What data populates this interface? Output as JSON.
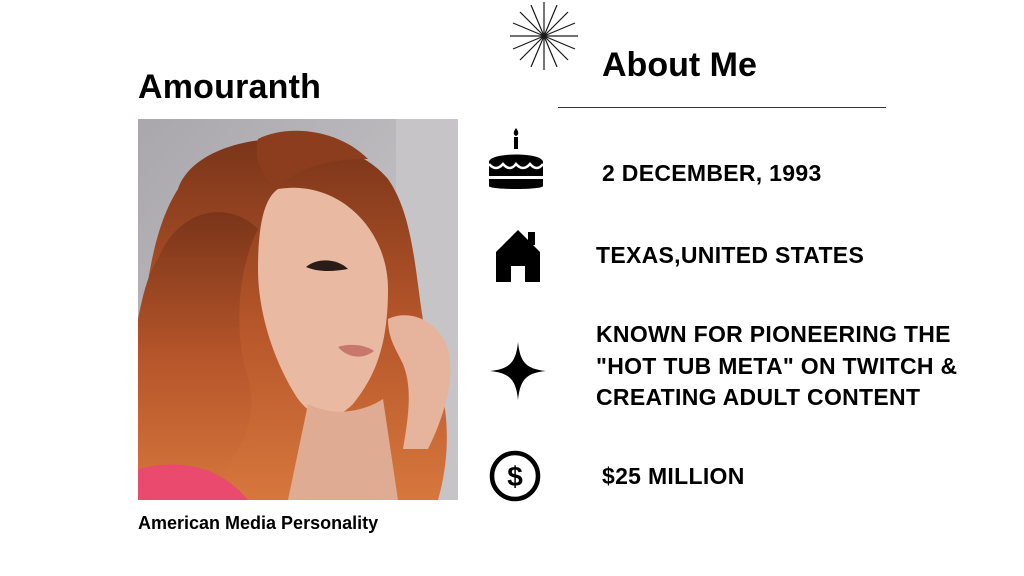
{
  "profile": {
    "name": "Amouranth",
    "caption": "American Media Personality"
  },
  "about": {
    "heading": "About Me",
    "facts": [
      {
        "icon": "birthday-cake-icon",
        "text": "2 DECEMBER, 1993"
      },
      {
        "icon": "house-icon",
        "text": "TEXAS,UNITED STATES"
      },
      {
        "icon": "sparkle-star-icon",
        "lines": [
          "KNOWN FOR PIONEERING THE",
          "\"HOT TUB META\" ON TWITCH &",
          "CREATING ADULT CONTENT"
        ]
      },
      {
        "icon": "dollar-coin-icon",
        "text": "$25 MILLION"
      }
    ]
  },
  "colors": {
    "background": "#ffffff",
    "text": "#000000",
    "hair": "#b5552a",
    "skin": "#e9b9a2",
    "top": "#e94a6e"
  }
}
